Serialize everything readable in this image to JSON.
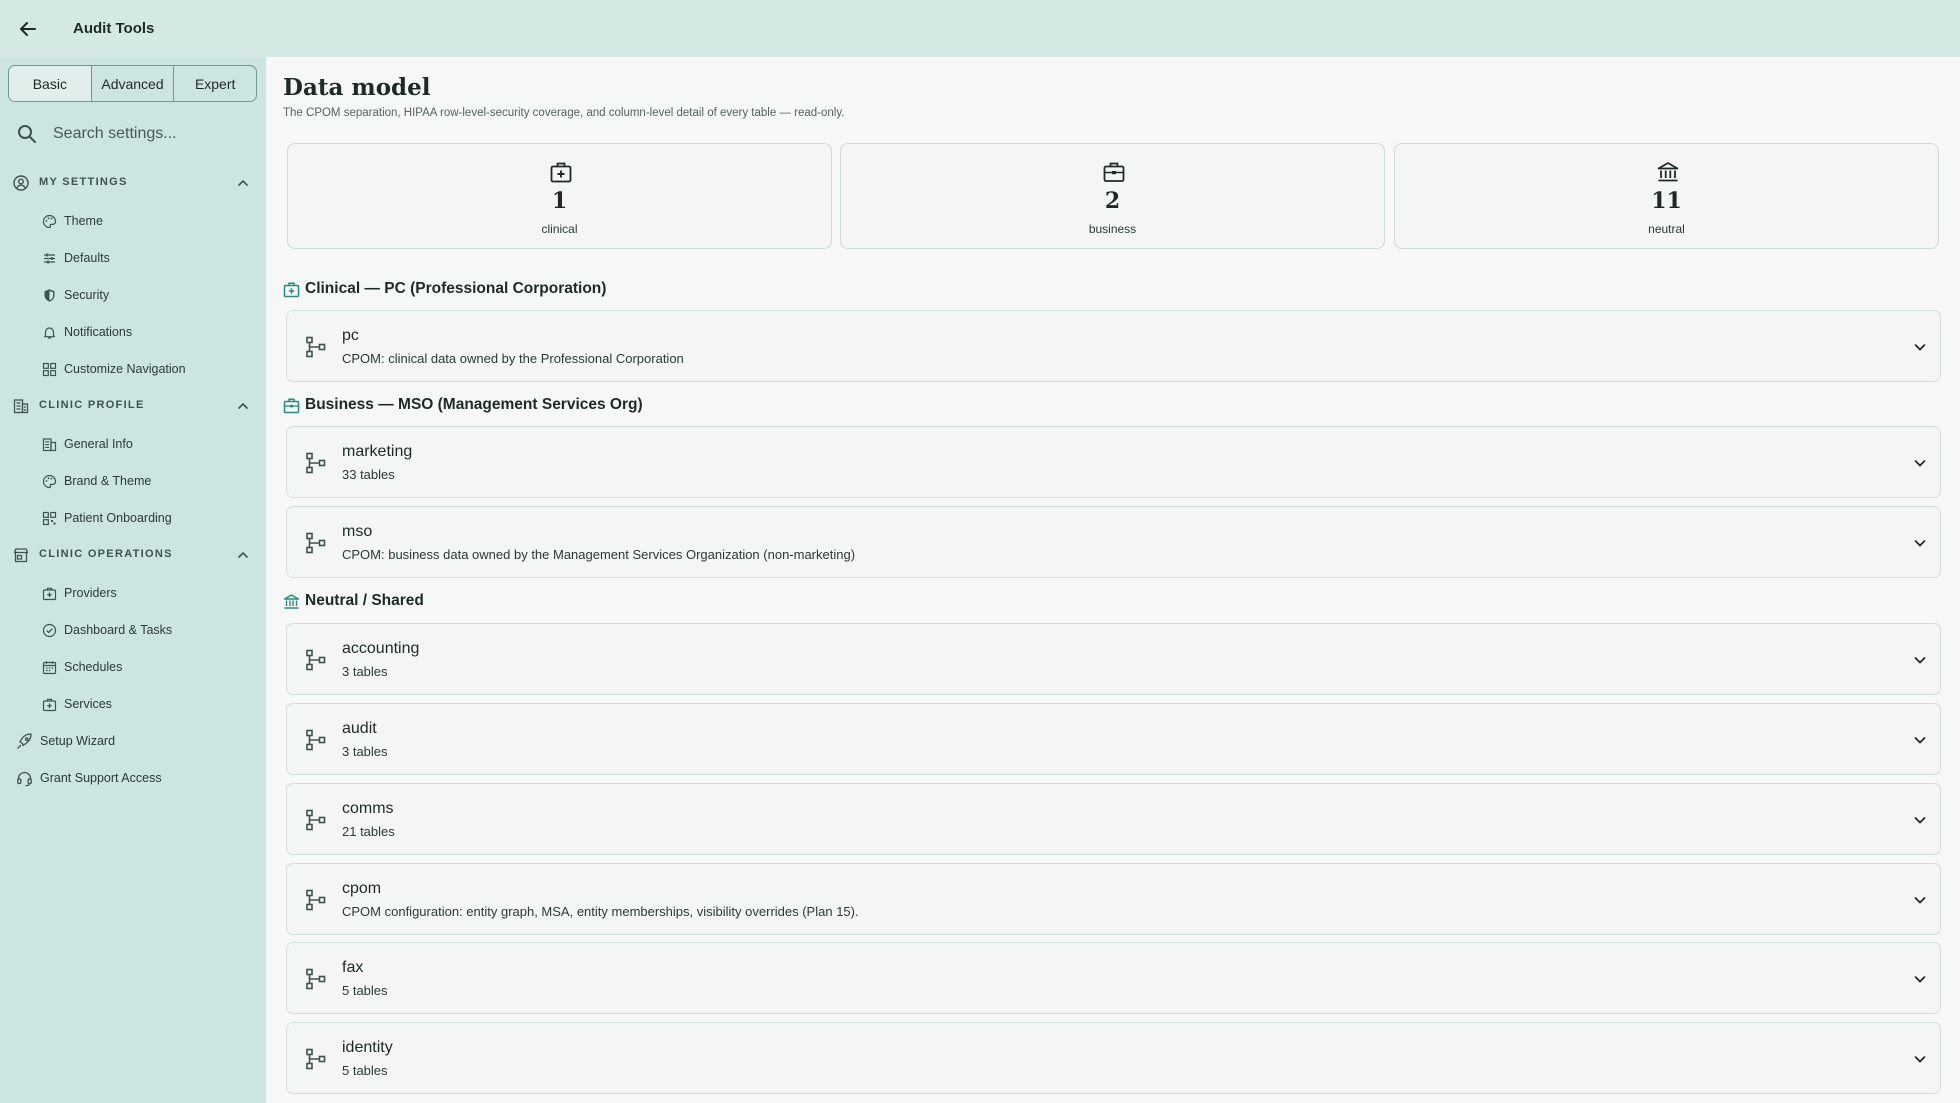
{
  "app": {
    "title": "Audit Tools"
  },
  "modes": [
    "Basic",
    "Advanced",
    "Expert"
  ],
  "search": {
    "placeholder": "Search settings..."
  },
  "sections": [
    {
      "label": "MY SETTINGS",
      "items": [
        "Theme",
        "Defaults",
        "Security",
        "Notifications",
        "Customize Navigation"
      ]
    },
    {
      "label": "CLINIC PROFILE",
      "items": [
        "General Info",
        "Brand & Theme",
        "Patient Onboarding"
      ]
    },
    {
      "label": "CLINIC OPERATIONS",
      "items": [
        "Providers",
        "Dashboard & Tasks",
        "Schedules",
        "Services"
      ]
    }
  ],
  "top_links": [
    "Setup Wizard",
    "Grant Support Access"
  ],
  "page": {
    "title": "Data model",
    "subtitle": "The CPOM separation, HIPAA row-level-security coverage, and column-level detail of every table — read-only."
  },
  "stats": [
    {
      "value": "1",
      "label": "clinical",
      "icon": "medical-bag-icon"
    },
    {
      "value": "2",
      "label": "business",
      "icon": "briefcase-icon"
    },
    {
      "value": "11",
      "label": "neutral",
      "icon": "bank-icon"
    }
  ],
  "groups": [
    {
      "label": "Clinical — PC (Professional Corporation)",
      "icon": "medical-bag-icon",
      "schemas": [
        {
          "name": "pc",
          "desc": "CPOM: clinical data owned by the Professional Corporation"
        }
      ]
    },
    {
      "label": "Business — MSO (Management Services Org)",
      "icon": "briefcase-icon",
      "schemas": [
        {
          "name": "marketing",
          "desc": "33 tables"
        },
        {
          "name": "mso",
          "desc": "CPOM: business data owned by the Management Services Organization (non-marketing)"
        }
      ]
    },
    {
      "label": "Neutral / Shared",
      "icon": "bank-icon",
      "schemas": [
        {
          "name": "accounting",
          "desc": "3 tables"
        },
        {
          "name": "audit",
          "desc": "3 tables"
        },
        {
          "name": "comms",
          "desc": "21 tables"
        },
        {
          "name": "cpom",
          "desc": "CPOM configuration: entity graph, MSA, entity memberships, visibility overrides (Plan 15)."
        },
        {
          "name": "fax",
          "desc": "5 tables"
        },
        {
          "name": "identity",
          "desc": "5 tables"
        }
      ]
    }
  ],
  "colors": {
    "accent": "#2a8a7e",
    "sidebar": "#cde5e1",
    "topbar": "#d4e8e4"
  }
}
